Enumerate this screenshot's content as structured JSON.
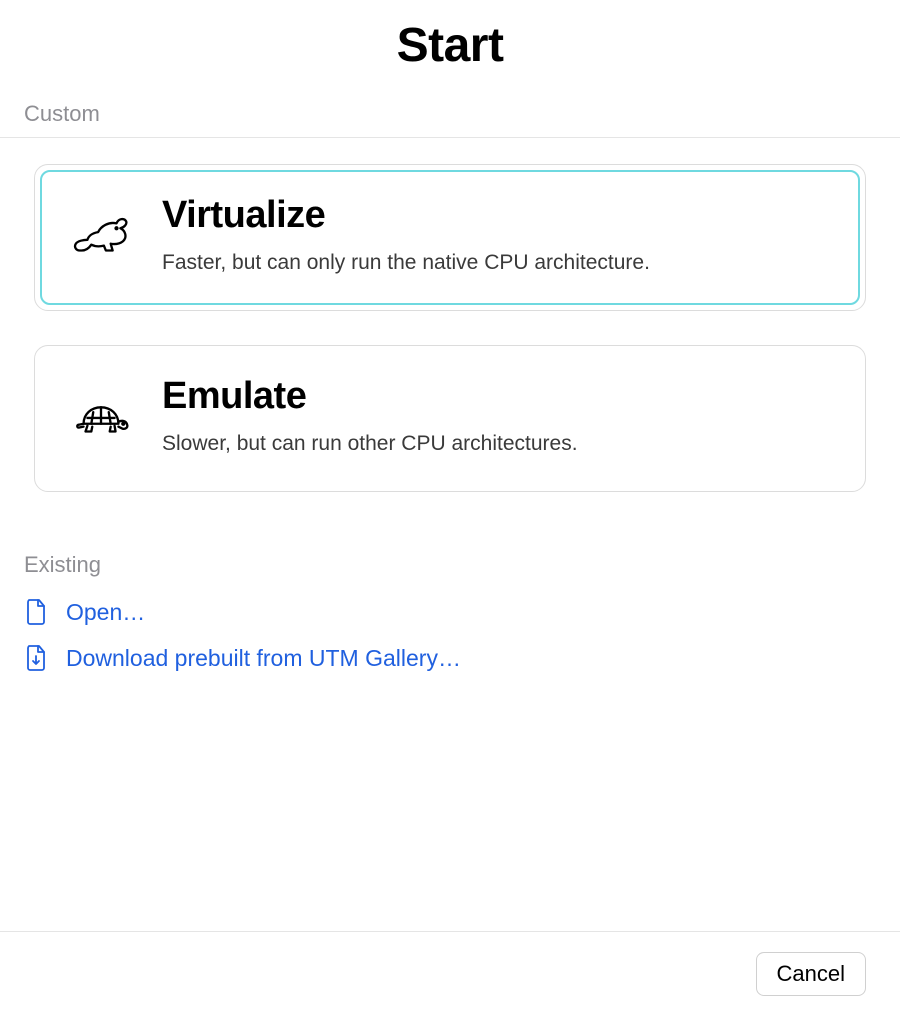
{
  "header": {
    "title": "Start"
  },
  "sections": {
    "custom_label": "Custom",
    "existing_label": "Existing"
  },
  "options": {
    "virtualize": {
      "title": "Virtualize",
      "description": "Faster, but can only run the native CPU architecture."
    },
    "emulate": {
      "title": "Emulate",
      "description": "Slower, but can run other CPU architectures."
    }
  },
  "links": {
    "open": "Open…",
    "download": "Download prebuilt from UTM Gallery…"
  },
  "footer": {
    "cancel": "Cancel"
  },
  "colors": {
    "link": "#2060df",
    "highlight": "#6fd9e0",
    "muted": "#8e8e93"
  }
}
